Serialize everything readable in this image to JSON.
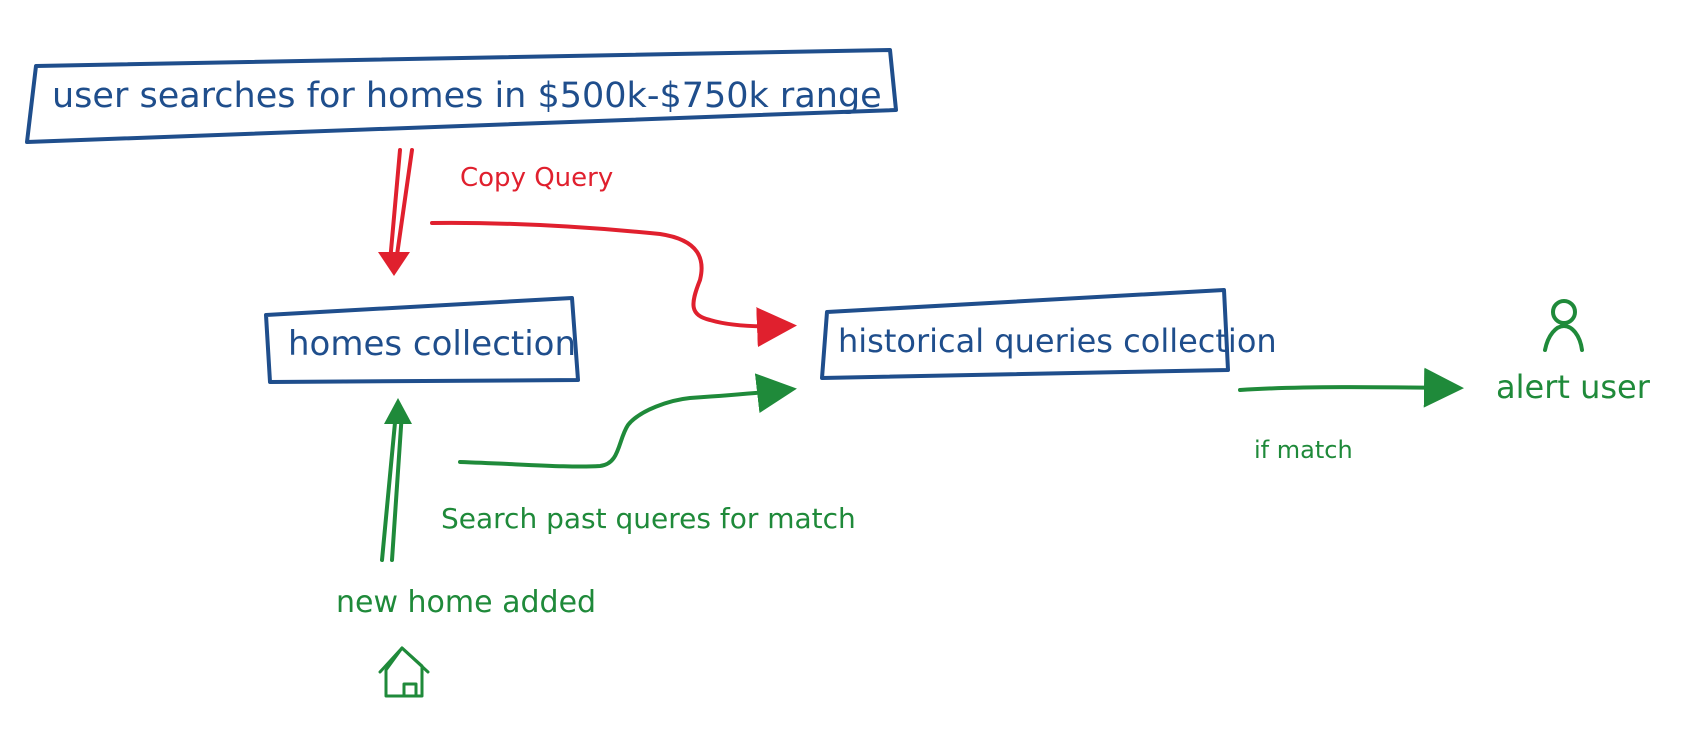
{
  "diagram": {
    "nodes": {
      "user_search": "user searches for homes in $500k-$750k range",
      "homes_collection": "homes collection",
      "historical_queries": "historical queries collection",
      "alert_user": "alert user",
      "new_home_added": "new home added"
    },
    "edge_labels": {
      "copy_query": "Copy Query",
      "search_past_queries": "Search past queres for match",
      "if_match": "if match"
    },
    "icons": {
      "user": "user-icon",
      "house": "house-icon"
    },
    "colors": {
      "blue": "#1f4e8c",
      "red": "#e0202e",
      "green": "#1f8a3a"
    }
  }
}
